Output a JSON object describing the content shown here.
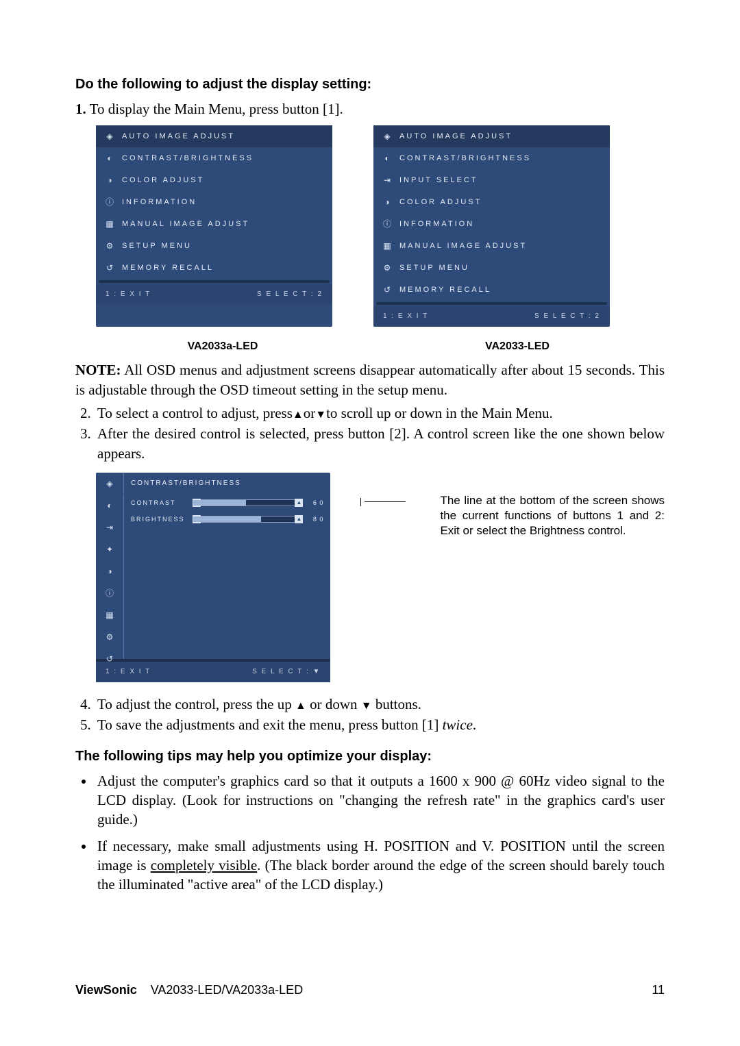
{
  "heading1": "Do the following to adjust the display setting:",
  "step1_num": "1.",
  "step1": "To display the Main Menu, press button [1].",
  "osd_left": {
    "items": [
      {
        "icon": "◈",
        "label": "AUTO IMAGE ADJUST",
        "sel": true
      },
      {
        "icon": "◐",
        "label": "CONTRAST/BRIGHTNESS"
      },
      {
        "icon": "◑",
        "label": "COLOR ADJUST"
      },
      {
        "icon": "ⓘ",
        "label": "INFORMATION"
      },
      {
        "icon": "▦",
        "label": "MANUAL IMAGE ADJUST"
      },
      {
        "icon": "⚙",
        "label": "SETUP MENU"
      },
      {
        "icon": "↺",
        "label": "MEMORY RECALL"
      }
    ],
    "foot_left": "1 : E X I T",
    "foot_right": "S E L E C T : 2"
  },
  "osd_right": {
    "items": [
      {
        "icon": "◈",
        "label": "AUTO IMAGE ADJUST",
        "sel": true
      },
      {
        "icon": "◐",
        "label": "CONTRAST/BRIGHTNESS"
      },
      {
        "icon": "⇥",
        "label": "INPUT SELECT"
      },
      {
        "icon": "◑",
        "label": "COLOR ADJUST"
      },
      {
        "icon": "ⓘ",
        "label": "INFORMATION"
      },
      {
        "icon": "▦",
        "label": "MANUAL IMAGE ADJUST"
      },
      {
        "icon": "⚙",
        "label": "SETUP MENU"
      },
      {
        "icon": "↺",
        "label": "MEMORY RECALL"
      }
    ],
    "foot_left": "1 : E X I T",
    "foot_right": "S E L E C T : 2"
  },
  "model_left": "VA2033a-LED",
  "model_right": "VA2033-LED",
  "note_label": "NOTE:",
  "note": " All OSD menus and adjustment screens disappear automatically after about 15 seconds. This is adjustable through the OSD timeout setting in the setup menu.",
  "step2_num": "2.",
  "step2a": "To select a control to adjust, press",
  "step2b": "or",
  "step2c": "to scroll up or down in the Main Menu.",
  "step3_num": "3.",
  "step3": "After the desired control is selected, press button [2]. A control screen like the one shown below appears.",
  "cb": {
    "title": "CONTRAST/BRIGHTNESS",
    "r1": {
      "label": "CONTRAST",
      "val": "6 0"
    },
    "r2": {
      "label": "BRIGHTNESS",
      "val": "8 0"
    },
    "side_icons": [
      "◐",
      "⇥",
      "✦",
      "◑",
      "ⓘ",
      "▦",
      "⚙",
      "↺"
    ],
    "head_icon": "◈",
    "foot_left": "1 : E X I T",
    "foot_right": "S E L E C T : ▼"
  },
  "callout": "The line at the bottom of the screen shows the current functions of buttons 1 and 2: Exit or select the Brightness control.",
  "step4_num": "4.",
  "step4a": "To adjust the control, press the up ",
  "step4b": " or down ",
  "step4c": " buttons.",
  "step5_num": "5.",
  "step5a": "To save the adjustments and exit the menu, press button [1] ",
  "step5b": "twice",
  "step5c": ".",
  "heading2": "The following tips may help you optimize your display:",
  "tip1": "Adjust the computer's graphics card so that it outputs a 1600 x 900 @ 60Hz video signal to the LCD display. (Look for instructions on \"changing the refresh rate\" in the graphics card's user guide.)",
  "tip2a": "If necessary, make small adjustments using H. POSITION and V. POSITION until the screen image is ",
  "tip2u": "completely visible",
  "tip2b": ". (The black border around the edge of the screen should barely touch the illuminated \"active area\" of the LCD display.)",
  "footer_brand": "ViewSonic",
  "footer_model": "VA2033-LED/VA2033a-LED",
  "footer_page": "11",
  "glyph_up": "▲",
  "glyph_down": "▼"
}
